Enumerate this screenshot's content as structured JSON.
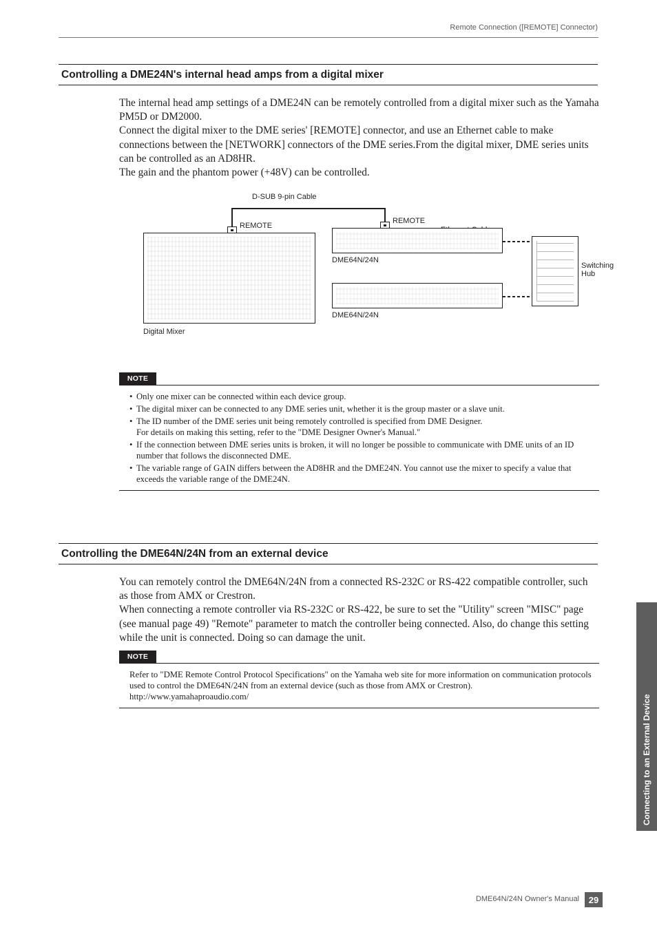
{
  "header": {
    "right": "Remote Connection ([REMOTE] Connector)"
  },
  "section1": {
    "title": "Controlling a DME24N's internal head amps from a digital mixer",
    "para": "The internal head amp settings of a DME24N can be remotely controlled from a digital mixer such as the Yamaha PM5D or DM2000.\nConnect the digital mixer to the DME series' [REMOTE] connector, and use an Ethernet cable to make connections between the [NETWORK] connectors of the DME series.From the digital mixer, DME series units can be controlled as an AD8HR.\nThe gain and the phantom power (+48V) can be controlled."
  },
  "diagram": {
    "cableTop": "D-SUB 9-pin Cable",
    "remote": "REMOTE",
    "ethernet": "Ethernet Cable",
    "hub": "Switching\nHub",
    "dmeLabel": "DME64N/24N",
    "mixerLabel": "Digital Mixer"
  },
  "note1_label": "NOTE",
  "note1": [
    "Only one mixer can be connected within each device group.",
    "The digital mixer can be connected to any DME series unit, whether it is the group master or a slave unit.",
    "The ID number of the DME series unit being remotely controlled is specified from DME Designer.\nFor details on making this setting, refer to the \"DME Designer Owner's Manual.\"",
    "If the connection between DME series units is broken, it will no longer be possible to communicate with DME units of an ID number that follows the disconnected DME.",
    "The variable range of GAIN differs between the AD8HR and the DME24N. You cannot use the mixer to specify a value that exceeds the variable range of the DME24N."
  ],
  "section2": {
    "title": "Controlling the DME64N/24N from an external device",
    "para": "You can remotely control the DME64N/24N from a connected RS-232C or RS-422 compatible controller, such as those from AMX or Crestron.\nWhen connecting a remote controller via RS-232C or RS-422, be sure to set the \"Utility\" screen \"MISC\" page (see manual page 49) \"Remote\" parameter to match the controller being connected. Also, do change this setting while the unit is connected. Doing so can damage the unit."
  },
  "note2_label": "NOTE",
  "note2": "Refer to \"DME Remote Control Protocol Specifications\" on the Yamaha web site for more information on communication protocols used to control the DME64N/24N from an external device (such as those from AMX or Crestron).\nhttp://www.yamahaproaudio.com/",
  "sideTab": "Connecting to an External Device",
  "footer": {
    "manual": "DME64N/24N Owner's Manual",
    "page": "29"
  }
}
